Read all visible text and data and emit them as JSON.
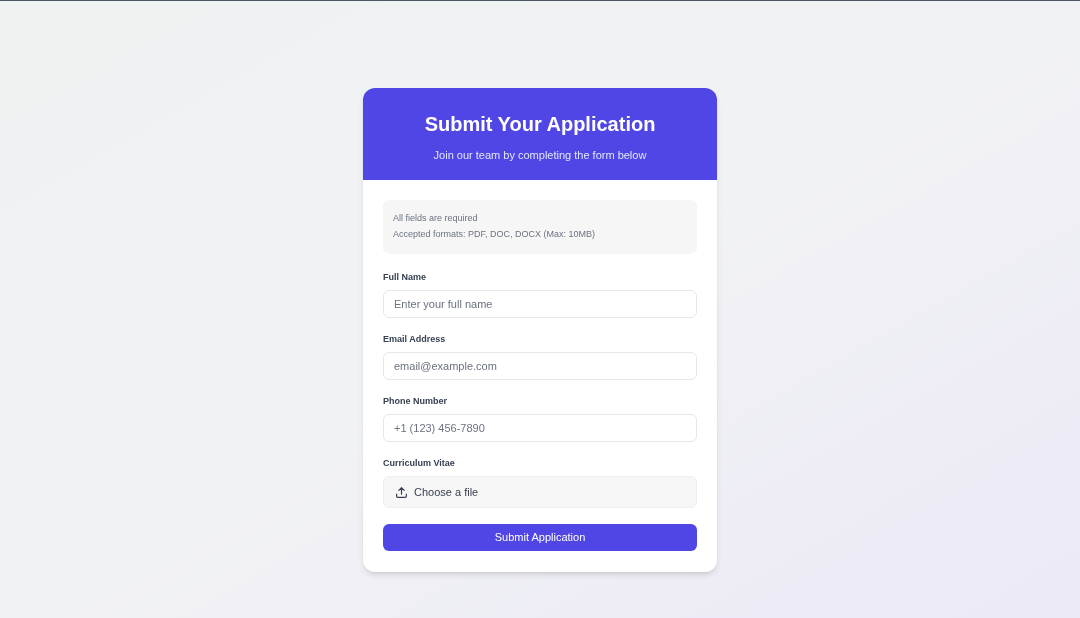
{
  "header": {
    "title": "Submit Your Application",
    "subtitle": "Join our team by completing the form below"
  },
  "notice": [
    "All fields are required",
    "Accepted formats: PDF, DOC, DOCX (Max: 10MB)"
  ],
  "fields": [
    {
      "kind": "text",
      "label": "Full Name",
      "placeholder": "Enter your full name"
    },
    {
      "kind": "text",
      "label": "Email Address",
      "placeholder": "email@example.com"
    },
    {
      "kind": "text",
      "label": "Phone Number",
      "placeholder": "+1 (123) 456-7890"
    },
    {
      "kind": "file",
      "label": "Curriculum Vitae",
      "placeholder": "Choose a file"
    }
  ],
  "submit": "Submit Application"
}
